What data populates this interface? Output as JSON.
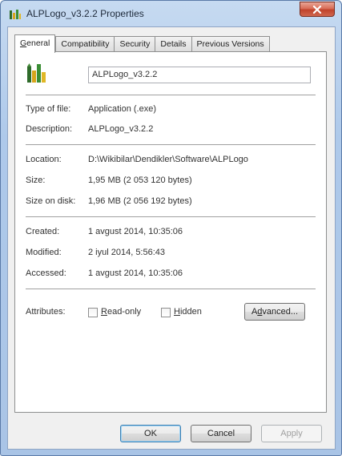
{
  "window": {
    "title": "ALPLogo_v3.2.2 Properties"
  },
  "tabs": [
    {
      "label_u": "G",
      "label_rest": "eneral"
    },
    {
      "label_u": "",
      "label_rest": "Compatibility"
    },
    {
      "label_u": "",
      "label_rest": "Security"
    },
    {
      "label_u": "",
      "label_rest": "Details"
    },
    {
      "label_u": "",
      "label_rest": "Previous Versions"
    }
  ],
  "file": {
    "name": "ALPLogo_v3.2.2",
    "type_label": "Type of file:",
    "type_value": "Application (.exe)",
    "description_label": "Description:",
    "description_value": "ALPLogo_v3.2.2",
    "location_label": "Location:",
    "location_value": "D:\\Wikibilar\\Dendikler\\Software\\ALPLogo",
    "size_label": "Size:",
    "size_value": "1,95 MB (2 053 120 bytes)",
    "size_on_disk_label": "Size on disk:",
    "size_on_disk_value": "1,96 MB (2 056 192 bytes)",
    "created_label": "Created:",
    "created_value": "1 avgust 2014, 10:35:06",
    "modified_label": "Modified:",
    "modified_value": "2 iyul 2014, 5:56:43",
    "accessed_label": "Accessed:",
    "accessed_value": "1 avgust 2014, 10:35:06"
  },
  "attributes": {
    "label": "Attributes:",
    "readonly_u": "R",
    "readonly_rest": "ead-only",
    "hidden_u": "H",
    "hidden_rest": "idden",
    "advanced_u": "d",
    "advanced_pre": "A",
    "advanced_rest": "vanced..."
  },
  "buttons": {
    "ok": "OK",
    "cancel": "Cancel",
    "apply": "Apply"
  },
  "colors": {
    "accent": "#3c7fb1",
    "close": "#c0432b"
  }
}
